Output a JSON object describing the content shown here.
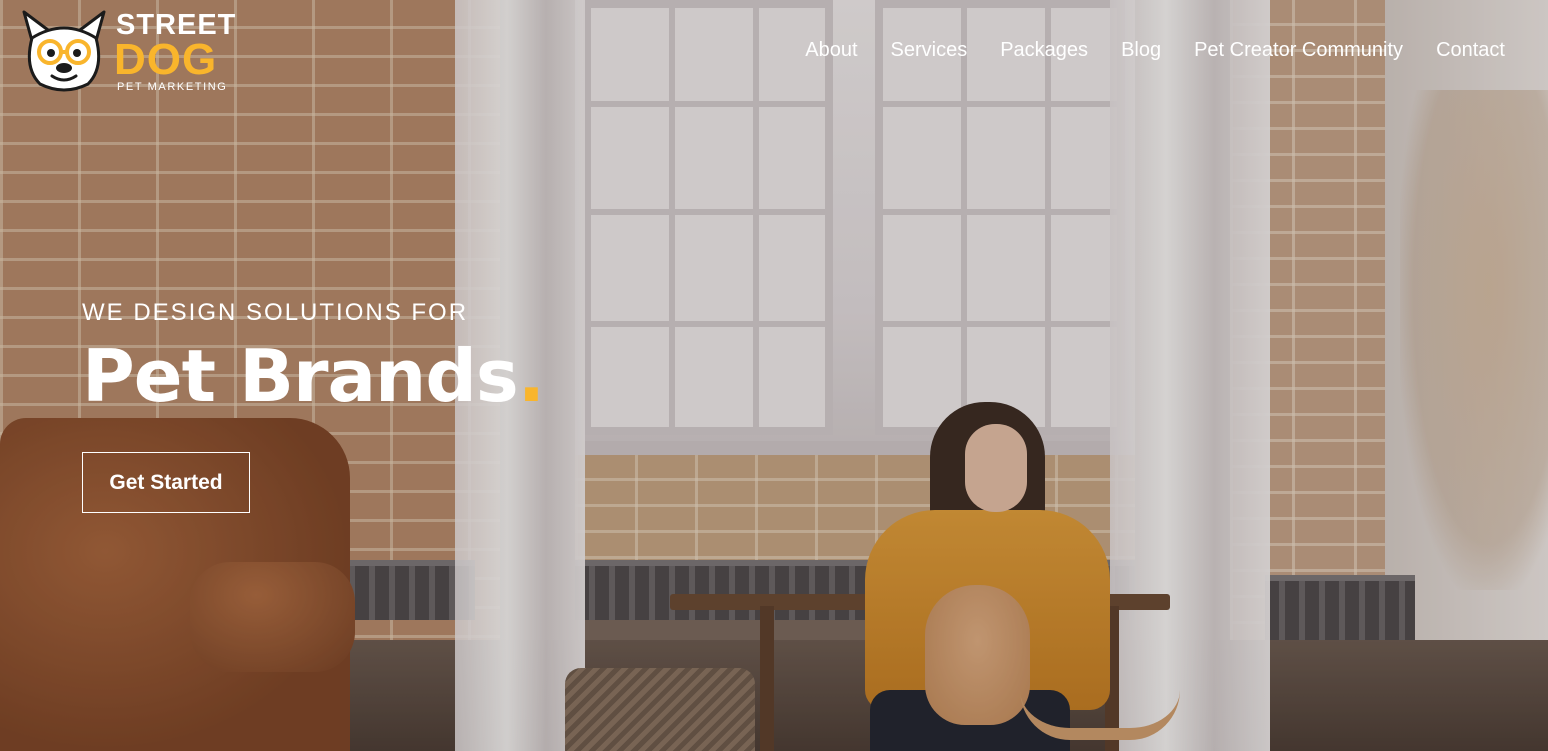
{
  "brand": {
    "line1": "STREET",
    "line2": "DOG",
    "tagline": "PET MARKETING",
    "logo_icon": "dog-with-glasses-icon",
    "accent_color": "#f9b52c"
  },
  "nav": {
    "items": [
      {
        "label": "About"
      },
      {
        "label": "Services"
      },
      {
        "label": "Packages"
      },
      {
        "label": "Blog"
      },
      {
        "label": "Pet Creator Community"
      },
      {
        "label": "Contact"
      }
    ]
  },
  "hero": {
    "eyebrow": "WE DESIGN SOLUTIONS FOR",
    "title": "Pet Brands",
    "title_punctuation": ".",
    "cta_label": "Get Started"
  }
}
